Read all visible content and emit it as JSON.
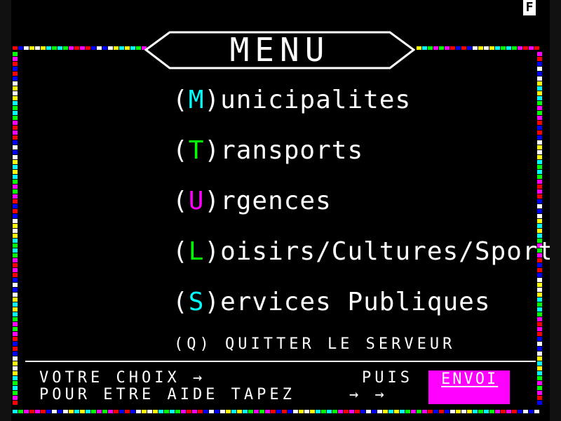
{
  "status_indicator": "F",
  "title": "MENU",
  "menu": {
    "items": [
      {
        "key": "M",
        "rest": "unicipalites",
        "color": "#00ffff"
      },
      {
        "key": "T",
        "rest": "ransports",
        "color": "#00ff00"
      },
      {
        "key": "U",
        "rest": "rgences",
        "color": "#ff00ff"
      },
      {
        "key": "L",
        "rest": "oisirs/Cultures/Sports",
        "color": "#00ff00"
      },
      {
        "key": "S",
        "rest": "ervices Publiques",
        "color": "#00ffff"
      }
    ],
    "paren_open": "(",
    "paren_close": ")",
    "quit": "(Q) QUITTER LE SERVEUR"
  },
  "footer": {
    "line1": "VOTRE CHOIX →",
    "line2": "POUR ETRE AIDE TAPEZ",
    "puis": "PUIS",
    "arrows": "→  →",
    "send_label": "ENVOI"
  },
  "colors": {
    "border_palette": [
      "#ff0000",
      "#00ff00",
      "#ffff00",
      "#0000ff",
      "#ff00ff",
      "#00ffff",
      "#ffffff"
    ],
    "send_button": "#ff00ff"
  }
}
